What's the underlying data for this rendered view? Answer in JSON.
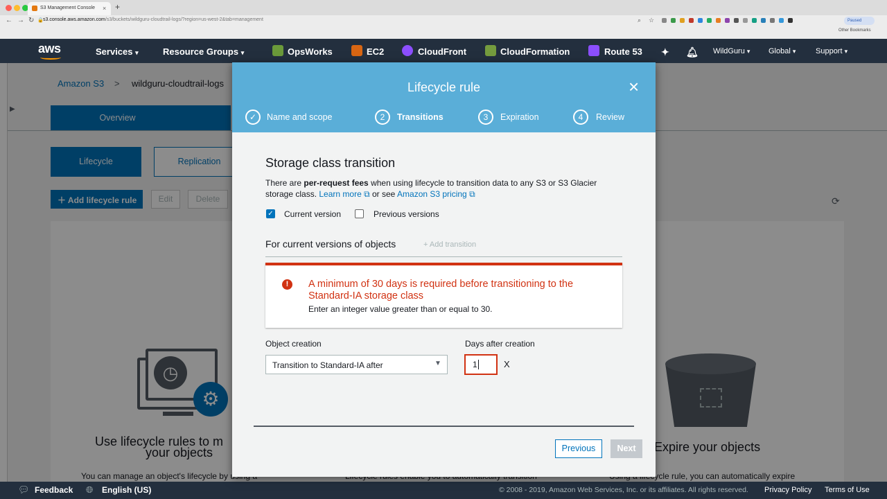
{
  "browser": {
    "tab_title": "S3 Management Console",
    "tab_close": "×",
    "new_tab": "+",
    "url_domain": "s3.console.aws.amazon.com",
    "url_path": "/s3/buckets/wildguru-cloudtrail-logs/?region=us-west-2&tab=management",
    "paused_label": "Paused",
    "bookmarks_label": "Other Bookmarks"
  },
  "aws_nav": {
    "logo": "aws",
    "services": "Services",
    "resource_groups": "Resource Groups",
    "opsworks": "OpsWorks",
    "ec2": "EC2",
    "cloudfront": "CloudFront",
    "cloudformation": "CloudFormation",
    "route53": "Route 53",
    "user": "WildGuru",
    "region": "Global",
    "support": "Support"
  },
  "page": {
    "breadcrumb_root": "Amazon S3",
    "breadcrumb_sep": ">",
    "breadcrumb_bucket": "wildguru-cloudtrail-logs",
    "tab_overview": "Overview",
    "subtab_lifecycle": "Lifecycle",
    "subtab_replication": "Replication",
    "add_rule": "Add lifecycle rule",
    "edit": "Edit",
    "delete": "Delete",
    "card1_title": "Use lifecycle rules to m",
    "card1_title2": "your objects",
    "card1_text": "You can manage an object's lifecycle by using a",
    "card2_text": "Lifecycle rules enable you to automatically transition",
    "card3_title": "Expire your objects",
    "card3_text": "Using a lifecycle rule, you can automatically expire"
  },
  "footer": {
    "feedback": "Feedback",
    "language": "English (US)",
    "copyright": "© 2008 - 2019, Amazon Web Services, Inc. or its affiliates. All rights reserved.",
    "privacy": "Privacy Policy",
    "terms": "Terms of Use"
  },
  "modal": {
    "title": "Lifecycle rule",
    "close": "×",
    "steps": [
      {
        "num": "✓",
        "label": "Name and scope"
      },
      {
        "num": "2",
        "label": "Transitions"
      },
      {
        "num": "3",
        "label": "Expiration"
      },
      {
        "num": "4",
        "label": "Review"
      }
    ],
    "section_title": "Storage class transition",
    "intro_1": "There are ",
    "intro_bold": "per-request fees",
    "intro_2": " when using lifecycle to transition data to any S3 or S3 Glacier",
    "intro_3": "storage class. ",
    "learn_more": "Learn more",
    "or_see": " or see ",
    "pricing_link": "Amazon S3 pricing",
    "current_version": "Current version",
    "previous_versions": "Previous versions",
    "current_checked": true,
    "previous_checked": false,
    "versions_heading": "For current versions of objects",
    "add_transition": "+ Add transition",
    "error_icon": "!",
    "error_title": "A minimum of 30 days is required before transitioning to the Standard-IA storage class",
    "error_desc": "Enter an integer value greater than or equal to 30.",
    "object_creation_label": "Object creation",
    "object_creation_value": "Transition to Standard-IA after",
    "days_label": "Days after creation",
    "days_value": "1",
    "remove": "X",
    "previous_button": "Previous",
    "next_button": "Next"
  },
  "colors": {
    "aws_nav": "#232f3e",
    "modal_header": "#5aaed8",
    "error": "#d13212",
    "link": "#0073bb"
  }
}
